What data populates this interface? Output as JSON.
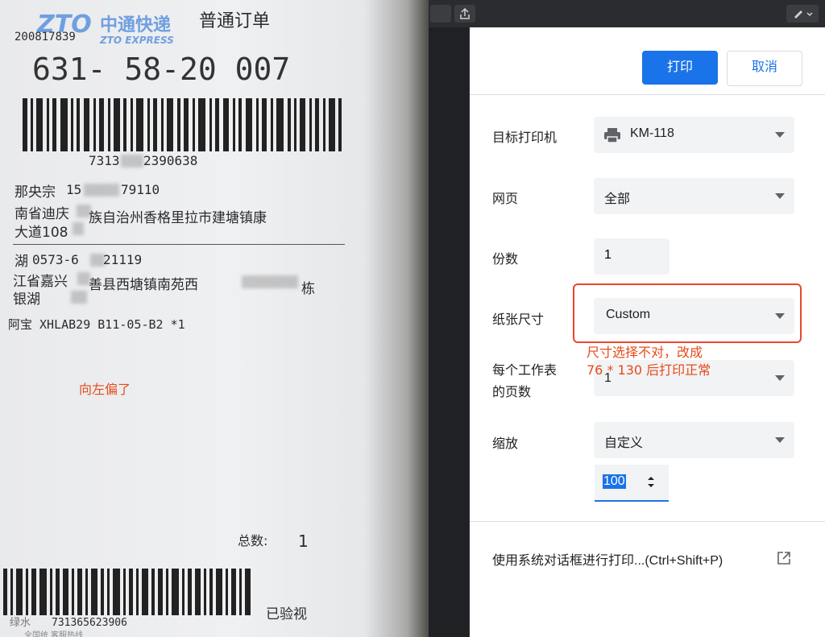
{
  "receipt": {
    "logo_cn": "中通快递",
    "logo_zto": "ZTO",
    "logo_en": "ZTO EXPRESS",
    "order_type": "普通订单",
    "small_number": "200817839",
    "big_code": "631- 58-20 007",
    "barcode_number_parts": [
      "7313",
      "2390638"
    ],
    "recipient_name": "那央宗",
    "recipient_phone_parts": [
      "15",
      "79110"
    ],
    "address_line1_parts": [
      "南省迪庆",
      "族自治州香格里拉市建塘镇康"
    ],
    "address_line2": "大道108",
    "sender_label_parts": [
      "湖",
      "0573-6",
      "21119"
    ],
    "sender_addr1_parts": [
      "江省嘉兴",
      "善县西塘镇南苑西",
      "栋"
    ],
    "sender_addr2": "银湖",
    "item_line": "阿宝 XHLAB29 B11-05-B2 *1",
    "annotation_left": "向左偏了",
    "total_label": "总数:",
    "total_value": "1",
    "verified": "已验视",
    "bottom_code": "731365623906",
    "bottom_green": "绿水",
    "bottom_tiny": "全国统  客服热线"
  },
  "dialog": {
    "print_button": "打印",
    "cancel_button": "取消",
    "rows": [
      {
        "label": "目标打印机",
        "value": "KM-118"
      },
      {
        "label": "网页",
        "value": "全部"
      },
      {
        "label": "份数",
        "value": "1"
      },
      {
        "label": "纸张尺寸",
        "value": "Custom"
      },
      {
        "label": "每个工作表",
        "label2": "的页数",
        "value": "1"
      },
      {
        "label": "缩放",
        "value": "自定义"
      }
    ],
    "scale_value": "100",
    "system_dialog_link": "使用系统对话框进行打印...(Ctrl+Shift+P)",
    "annotation_line1": "尺寸选择不对，改成",
    "annotation_line2": "76 * 130 后打印正常",
    "accent_color": "#1a73e8",
    "annotation_color": "#e64a19"
  }
}
